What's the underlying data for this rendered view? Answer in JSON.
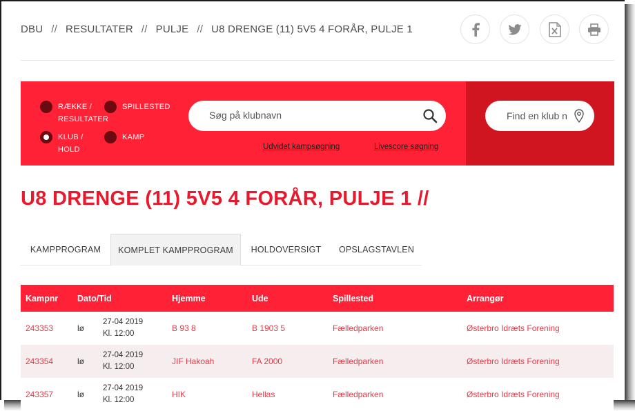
{
  "breadcrumb": [
    "DBU",
    "RESULTATER",
    "PULJE",
    "U8 DRENGE (11) 5V5 4 FORÅR, PULJE 1"
  ],
  "breadcrumb_separator": "//",
  "share_icons": [
    "facebook-icon",
    "twitter-icon",
    "excel-icon",
    "print-icon"
  ],
  "search_options": [
    {
      "label_1": "RÆKKE /",
      "label_2": "RESULTATER",
      "selected": false
    },
    {
      "label_1": "SPILLESTED",
      "label_2": "",
      "selected": false
    },
    {
      "label_1": "KLUB /",
      "label_2": "HOLD",
      "selected": true
    },
    {
      "label_1": "KAMP",
      "label_2": "",
      "selected": false
    }
  ],
  "search": {
    "placeholder": "Søg på klubnavn"
  },
  "links": {
    "advanced": "Udvidet kampsøgning",
    "livescore": "Livescore søgning"
  },
  "club_finder": {
    "placeholder": "Find en klub n"
  },
  "page_title": "U8 DRENGE (11) 5V5 4 FORÅR, PULJE 1 //",
  "tabs": [
    {
      "label": "KAMPPROGRAM",
      "active": false
    },
    {
      "label": "KOMPLET KAMPPROGRAM",
      "active": true
    },
    {
      "label": "HOLDOVERSIGT",
      "active": false
    },
    {
      "label": "OPSLAGSTAVLEN",
      "active": false
    }
  ],
  "table": {
    "headers": [
      "Kampnr",
      "Dato/Tid",
      "Hjemme",
      "Ude",
      "Spillested",
      "Arrangør"
    ],
    "rows": [
      {
        "kampnr": "243353",
        "day": "lø",
        "date": "27-04 2019",
        "time": "Kl. 12:00",
        "home": "B 93 8",
        "away": "B 1903 5",
        "venue": "Fælledparken",
        "organizer": "Østerbro Idræts Forening"
      },
      {
        "kampnr": "243354",
        "day": "lø",
        "date": "27-04 2019",
        "time": "Kl. 12:00",
        "home": "JIF Hakoah",
        "away": "FA 2000",
        "venue": "Fælledparken",
        "organizer": "Østerbro Idræts Forening"
      },
      {
        "kampnr": "243357",
        "day": "lø",
        "date": "27-04 2019",
        "time": "Kl. 12:00",
        "home": "HIK",
        "away": "Hellas",
        "venue": "Fælledparken",
        "organizer": "Østerbro Idræts Forening"
      }
    ]
  },
  "colors": {
    "brand_red": "#ff2136",
    "dark_red": "#d11520",
    "title_red": "#e8192c",
    "link_red": "#e33b47"
  }
}
